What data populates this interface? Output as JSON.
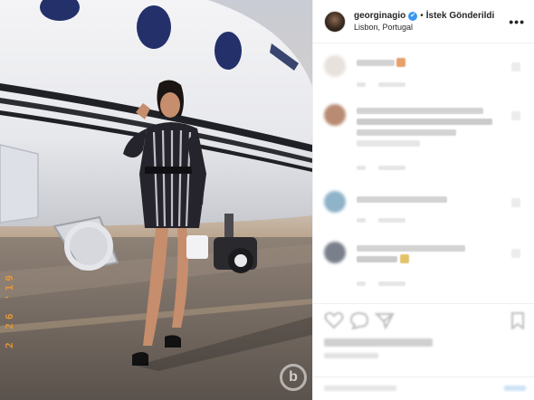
{
  "post": {
    "username": "georginagio",
    "verified_symbol": "✔",
    "separator": "•",
    "follow_status": "İstek Gönderildi",
    "location": "Lisbon, Portugal",
    "more_options": "•••"
  },
  "photo": {
    "date_stamp": "2 26 '19",
    "watermark": "b"
  },
  "icons": {
    "verified": "verified-badge-icon",
    "more": "more-options-icon",
    "like": "heart-icon",
    "comment": "comment-icon",
    "share": "share-icon",
    "save": "bookmark-icon"
  },
  "colors": {
    "verified_blue": "#3897f0",
    "border": "#efefef",
    "date_stamp": "#f19a32"
  }
}
